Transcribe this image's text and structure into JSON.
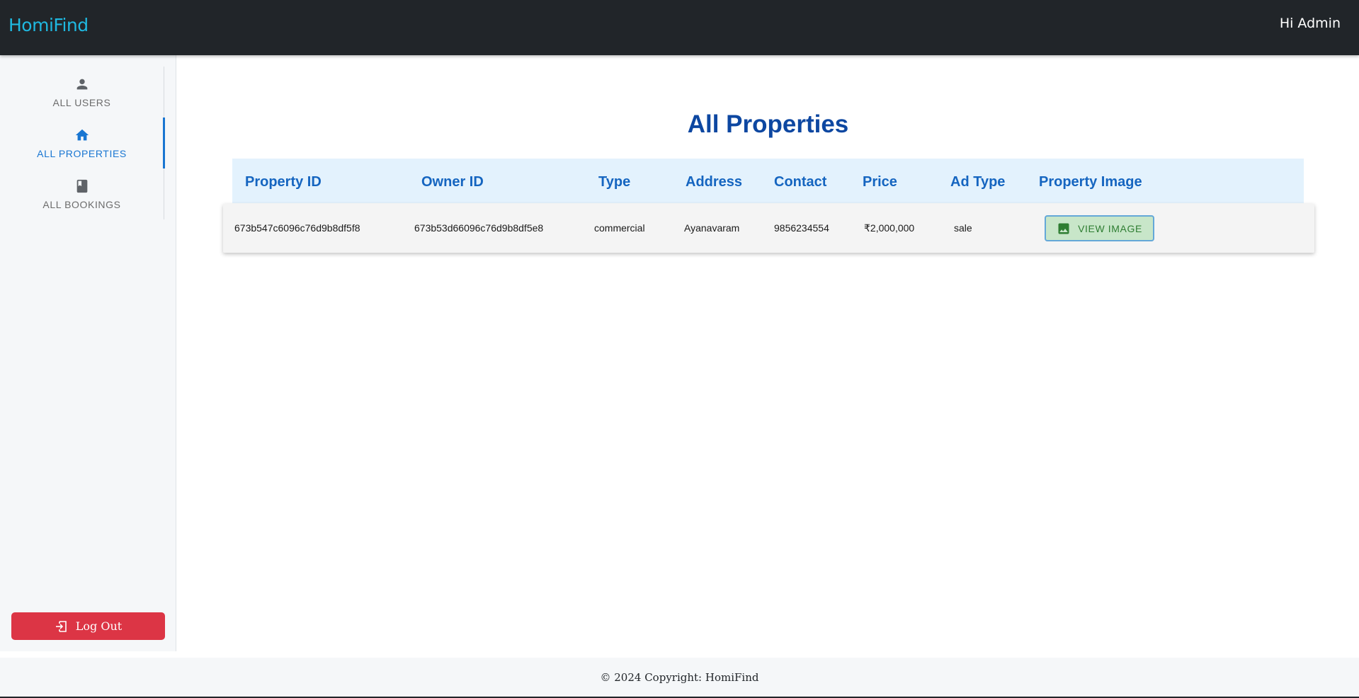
{
  "header": {
    "brand": "HomiFind",
    "greeting": "Hi Admin",
    "background_color": "#212529",
    "brand_color": "#1fb8e0"
  },
  "sidebar": {
    "items": [
      {
        "label": "ALL USERS",
        "icon": "person-icon",
        "active": false
      },
      {
        "label": "ALL PROPERTIES",
        "icon": "home-icon",
        "active": true
      },
      {
        "label": "ALL BOOKINGS",
        "icon": "book-icon",
        "active": false
      }
    ],
    "active_color": "#1976d2",
    "logout_label": "Log Out",
    "logout_icon": "logout-icon",
    "logout_color": "#dc3545"
  },
  "main": {
    "title": "All Properties",
    "title_color": "#0d47a1",
    "table": {
      "columns": [
        "Property ID",
        "Owner ID",
        "Type",
        "Address",
        "Contact",
        "Price",
        "Ad Type",
        "Property Image"
      ],
      "header_background": "#e3f2fd",
      "rows": [
        {
          "property_id": "673b547c6096c76d9b8df5f8",
          "owner_id": "673b53d66096c76d9b8df5e8",
          "type": "commercial",
          "address": "Ayanavaram",
          "contact": "9856234554",
          "price": "₹2,000,000",
          "ad_type": "sale",
          "image_button_label": "VIEW IMAGE",
          "image_button_icon": "image-icon"
        }
      ]
    }
  },
  "footer": {
    "text": "© 2024 Copyright: HomiFind"
  }
}
